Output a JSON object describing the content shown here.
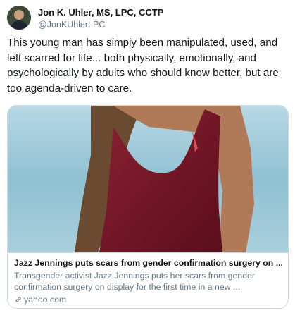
{
  "author": {
    "name": "Jon K. Uhler, MS, LPC, CCTP",
    "handle": "@JonKUhlerLPC"
  },
  "tweet": {
    "text": "This young man has simply been manipulated, used, and left scarred for life... both physically, emotionally, and psychologically by adults who should know better, but are too agenda-driven to care."
  },
  "card": {
    "title": "Jazz Jennings puts scars from gender confirmation surgery on ...",
    "description": "Transgender activist Jazz Jennings puts her scars from gender confirmation surgery on display for the first time in a new ...",
    "domain": "yahoo.com",
    "domain_icon": "link-icon"
  },
  "colors": {
    "text": "#14171a",
    "secondary": "#657786",
    "border": "#ccd6dd",
    "swimsuit": "#7a1a2a",
    "water": "#9ec9d9"
  }
}
